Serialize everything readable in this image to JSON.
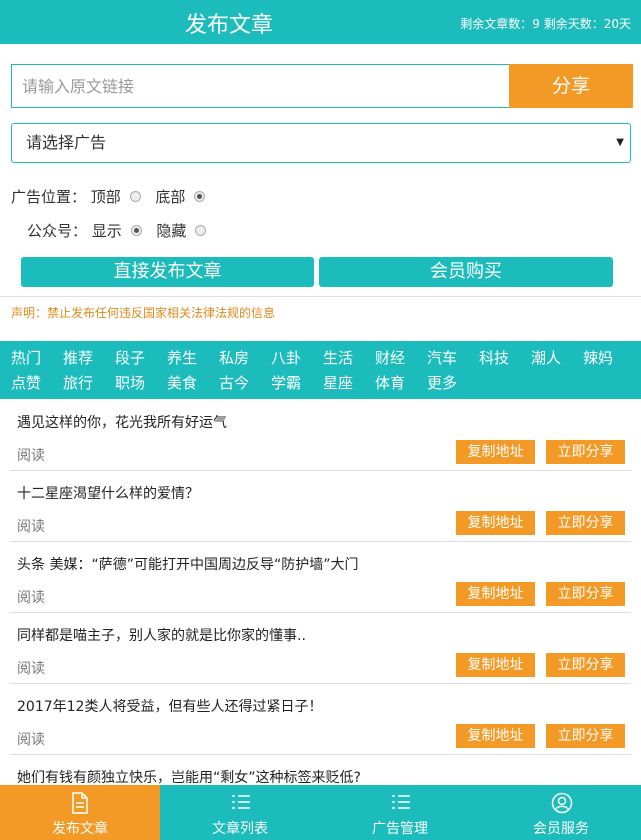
{
  "header": {
    "title": "发布文章",
    "stats": "剩余文章数：9  剩余天数：20天"
  },
  "url_input": {
    "placeholder": "请输入原文链接",
    "value": ""
  },
  "share_button": "分享",
  "ad_select": {
    "selected": "请选择广告"
  },
  "ad_position": {
    "label": "广告位置：",
    "options": [
      {
        "label": "顶部",
        "checked": false
      },
      {
        "label": "底部",
        "checked": true
      }
    ]
  },
  "public_account": {
    "label": "公众号：",
    "options": [
      {
        "label": "显示",
        "checked": true
      },
      {
        "label": "隐藏",
        "checked": false
      }
    ]
  },
  "buttons": {
    "publish": "直接发布文章",
    "member_buy": "会员购买"
  },
  "notice": "声明：禁止发布任何违反国家相关法律法规的信息",
  "categories": [
    "热门",
    "推荐",
    "段子",
    "养生",
    "私房",
    "八卦",
    "生活",
    "财经",
    "汽车",
    "科技",
    "潮人",
    "辣妈",
    "点赞",
    "旅行",
    "职场",
    "美食",
    "古今",
    "学霸",
    "星座",
    "体育",
    "更多"
  ],
  "articles": [
    {
      "title": "遇见这样的你，花光我所有好运气",
      "read": "阅读",
      "copy": "复制地址",
      "share": "立即分享"
    },
    {
      "title": "十二星座渴望什么样的爱情？",
      "read": "阅读",
      "copy": "复制地址",
      "share": "立即分享"
    },
    {
      "title": "头条 美媒：“萨德”可能打开中国周边反导“防护墙”大门",
      "read": "阅读",
      "copy": "复制地址",
      "share": "立即分享"
    },
    {
      "title": "同样都是喵主子，别人家的就是比你家的懂事..",
      "read": "阅读",
      "copy": "复制地址",
      "share": "立即分享"
    },
    {
      "title": "2017年12类人将受益，但有些人还得过紧日子！",
      "read": "阅读",
      "copy": "复制地址",
      "share": "立即分享"
    },
    {
      "title": "她们有钱有颜独立快乐，岂能用“剩女”这种标签来贬低?",
      "read": "",
      "copy": "",
      "share": ""
    }
  ],
  "bottom_nav": [
    {
      "label": "发布文章",
      "icon": "document-icon",
      "active": true
    },
    {
      "label": "文章列表",
      "icon": "list-icon",
      "active": false
    },
    {
      "label": "广告管理",
      "icon": "list-icon",
      "active": false
    },
    {
      "label": "会员服务",
      "icon": "user-icon",
      "active": false
    }
  ],
  "colors": {
    "primary": "#1cbcbc",
    "accent": "#f39a26",
    "notice": "#e08a1c"
  }
}
